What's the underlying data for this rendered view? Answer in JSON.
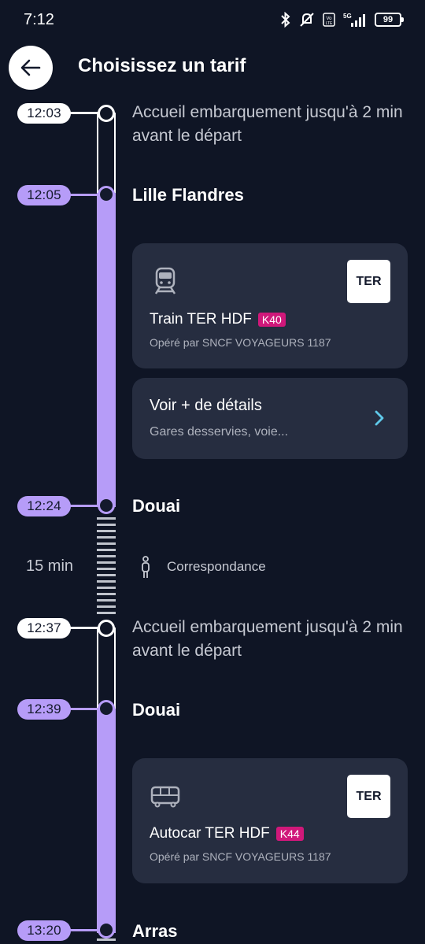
{
  "status_bar": {
    "time": "7:12",
    "battery": "99",
    "network": "5G"
  },
  "header": {
    "title": "Choisissez un tarif",
    "back_icon": "arrow-left-icon"
  },
  "timeline": {
    "boarding_1": {
      "time": "12:03",
      "text": "Accueil embarquement jusqu'à 2 min avant le départ"
    },
    "stop_1": {
      "time": "12:05",
      "station": "Lille Flandres"
    },
    "train_card": {
      "icon": "train-icon",
      "title": "Train TER HDF",
      "line_code": "K40",
      "operator": "Opéré par SNCF VOYAGEURS 1187",
      "badge": "TER"
    },
    "details_card": {
      "title": "Voir + de détails",
      "subtitle": "Gares desservies, voie...",
      "icon": "chevron-right-icon"
    },
    "stop_2": {
      "time": "12:24",
      "station": "Douai"
    },
    "connection": {
      "duration": "15 min",
      "label": "Correspondance",
      "icon": "walking-person-icon"
    },
    "boarding_2": {
      "time": "12:37",
      "text": "Accueil embarquement jusqu'à 2 min avant le départ"
    },
    "stop_3": {
      "time": "12:39",
      "station": "Douai"
    },
    "bus_card": {
      "icon": "bus-icon",
      "title": "Autocar TER HDF",
      "line_code": "K44",
      "operator": "Opéré par SNCF VOYAGEURS 1187",
      "badge": "TER"
    },
    "stop_4": {
      "time": "13:20",
      "station": "Arras"
    }
  },
  "colors": {
    "background": "#0f1525",
    "accent_purple": "#b69cf8",
    "card": "#262d40",
    "line_code": "#d0187a",
    "chevron": "#5fc8e8"
  }
}
